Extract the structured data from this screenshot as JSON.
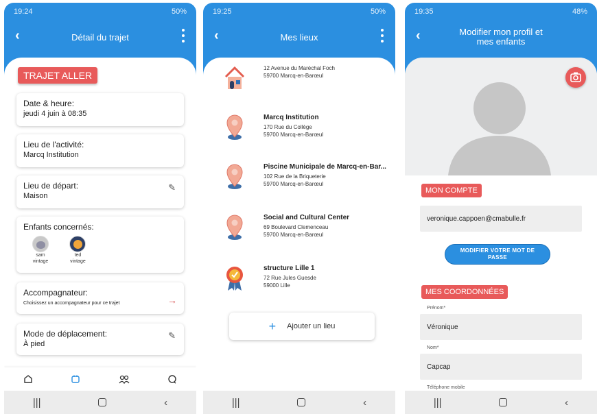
{
  "screen1": {
    "status_time": "19:24",
    "status_battery": "50%",
    "title": "Détail du trajet",
    "trip_badge": "TRAJET ALLER",
    "date_label": "Date & heure:",
    "date_value": "jeudi 4 juin à 08:35",
    "activity_label": "Lieu de l'activité:",
    "activity_value": "Marcq Institution",
    "departure_label": "Lieu de départ:",
    "departure_value": "Maison",
    "children_label": "Enfants concernés:",
    "children": [
      {
        "name_line1": "sam",
        "name_line2": "vintage"
      },
      {
        "name_line1": "ted",
        "name_line2": "vintage"
      }
    ],
    "companion_label": "Accompagnateur:",
    "companion_hint": "Choisissez un accompagnateur pour ce trajet",
    "mode_label": "Mode de déplacement:",
    "mode_value": "À pied"
  },
  "screen2": {
    "status_time": "19:25",
    "status_battery": "50%",
    "title": "Mes lieux",
    "places": [
      {
        "name": "",
        "line1": "12 Avenue du Maréchal Foch",
        "line2": "59700 Marcq-en-Barœul",
        "icon": "house-icon"
      },
      {
        "name": "Marcq Institution",
        "line1": "170 Rue du Collège",
        "line2": "59700 Marcq-en-Barœul",
        "icon": "pin-icon"
      },
      {
        "name": "Piscine Municipale de Marcq-en-Bar...",
        "line1": "102 Rue de la Briqueterie",
        "line2": "59700 Marcq-en-Barœul",
        "icon": "pin-icon"
      },
      {
        "name": "Social and Cultural Center",
        "line1": "69 Boulevard Clemenceau",
        "line2": "59700 Marcq-en-Barœul",
        "icon": "pin-icon"
      },
      {
        "name": "structure Lille 1",
        "line1": "72 Rue Jules Guesde",
        "line2": "59000 Lille",
        "icon": "award-badge-icon"
      }
    ],
    "add_label": "Ajouter un lieu"
  },
  "screen3": {
    "status_time": "19:35",
    "status_battery": "48%",
    "title_line1": "Modifier mon profil et",
    "title_line2": "mes enfants",
    "account_label": "MON COMPTE",
    "email_value": "veronique.cappoen@cmabulle.fr",
    "password_button_line1": "MODIFIER VOTRE MOT DE",
    "password_button_line2": "PASSE",
    "contact_label": "MES COORDONNÉES",
    "firstname_caption": "Prénom*",
    "firstname_value": "Véronique",
    "lastname_caption": "Nom*",
    "lastname_value": "Capcap",
    "phone_caption": "Téléphone mobile"
  },
  "colors": {
    "primary_blue": "#2b8fe0",
    "accent_red": "#e85a5a",
    "pin_fill": "#f2a995",
    "pin_base": "#3f6fa8"
  }
}
